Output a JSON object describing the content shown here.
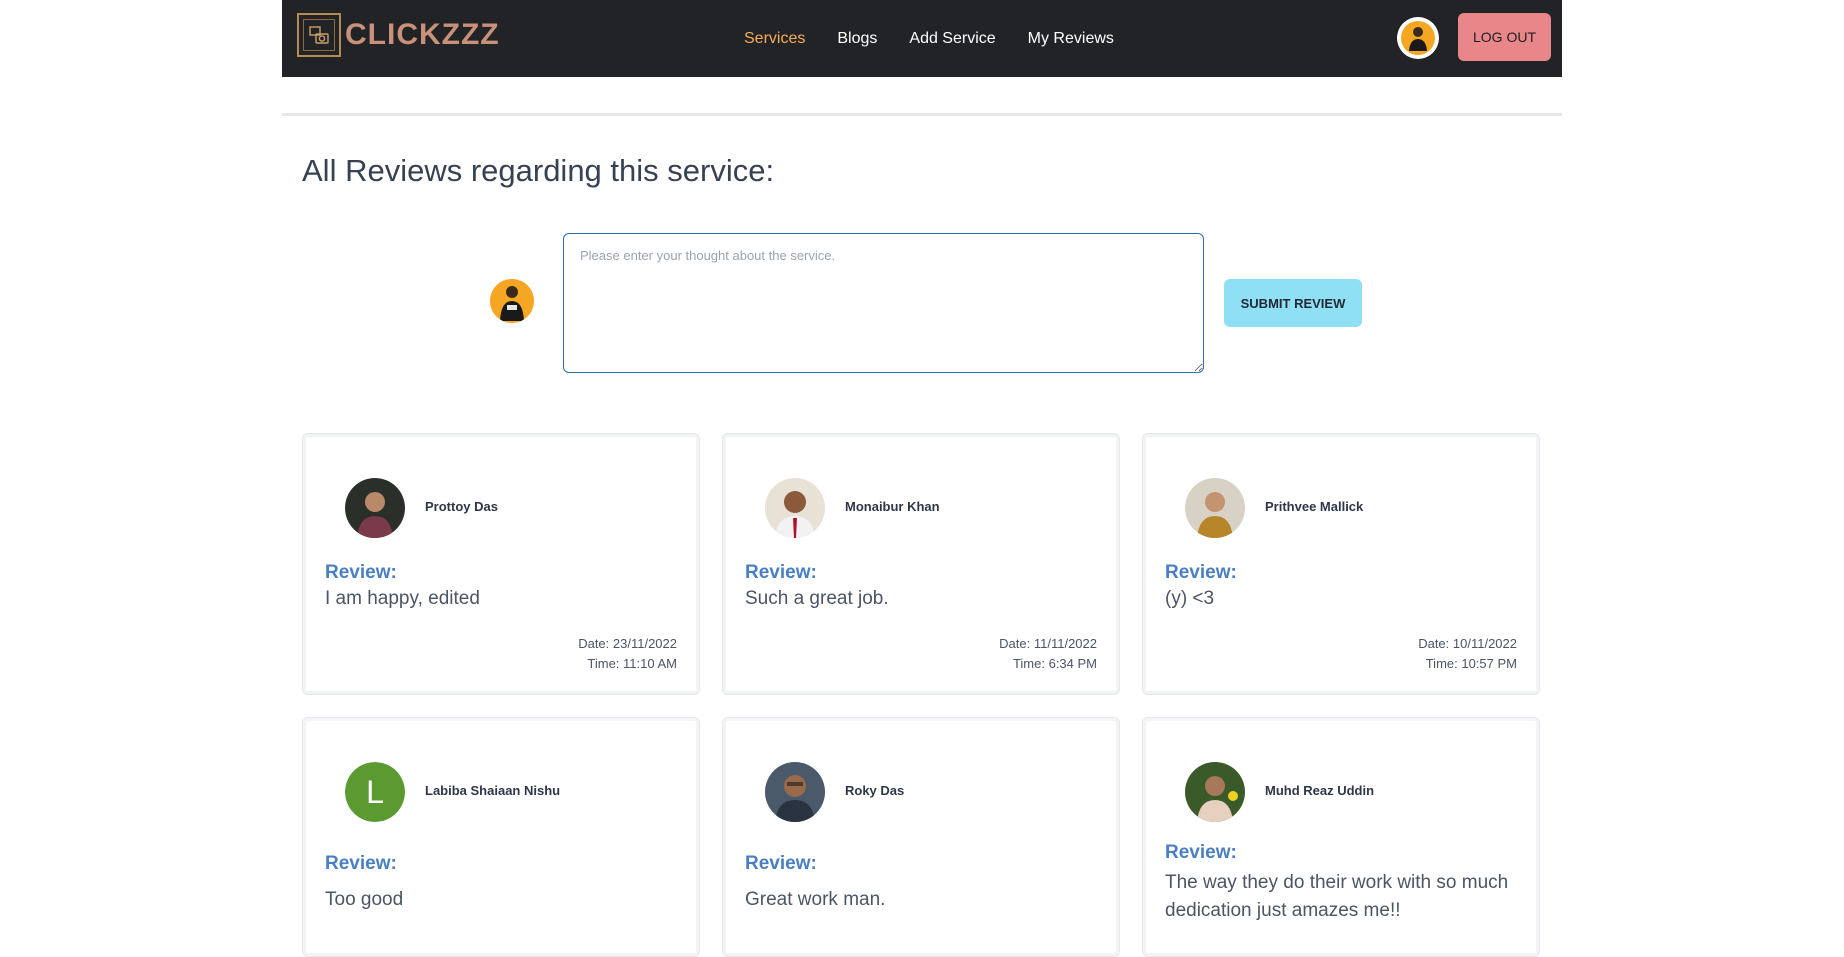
{
  "brand": {
    "name": "CLICKZZZ",
    "logo_icon": "camera-frame-icon"
  },
  "nav": {
    "links": [
      {
        "label": "Services",
        "active": true
      },
      {
        "label": "Blogs",
        "active": false
      },
      {
        "label": "Add Service",
        "active": false
      },
      {
        "label": "My Reviews",
        "active": false
      }
    ],
    "logout_label": "LOG OUT"
  },
  "page": {
    "title": "All Reviews regarding this service:"
  },
  "form": {
    "placeholder": "Please enter your thought about the service.",
    "value": "",
    "submit_label": "SUBMIT REVIEW"
  },
  "reviews": [
    {
      "name": "Prottoy Das",
      "label": "Review:",
      "text": "I am happy, edited",
      "date": "Date: 23/11/2022",
      "time": "Time: 11:10 AM",
      "avatar": "photo"
    },
    {
      "name": "Monaibur Khan",
      "label": "Review:",
      "text": "Such a great job.",
      "date": "Date: 11/11/2022",
      "time": "Time: 6:34 PM",
      "avatar": "photo"
    },
    {
      "name": "Prithvee Mallick",
      "label": "Review:",
      "text": "(y) <3",
      "date": "Date: 10/11/2022",
      "time": "Time: 10:57 PM",
      "avatar": "photo"
    },
    {
      "name": "Labiba Shaiaan Nishu",
      "label": "Review:",
      "text": "Too good",
      "avatar": "letter",
      "letter": "L"
    },
    {
      "name": "Roky Das",
      "label": "Review:",
      "text": "Great work man.",
      "avatar": "photo"
    },
    {
      "name": "Muhd Reaz Uddin",
      "label": "Review:",
      "text": "The way they do their work with so much dedication just amazes me!!",
      "avatar": "photo"
    }
  ],
  "colors": {
    "navbar_bg": "#222326",
    "active_link": "#f6ad55",
    "logout_bg": "#e8868a",
    "submit_bg": "#90e0f5",
    "review_label": "#4a7fc1",
    "letter_avatar_bg": "#5a9a30"
  }
}
